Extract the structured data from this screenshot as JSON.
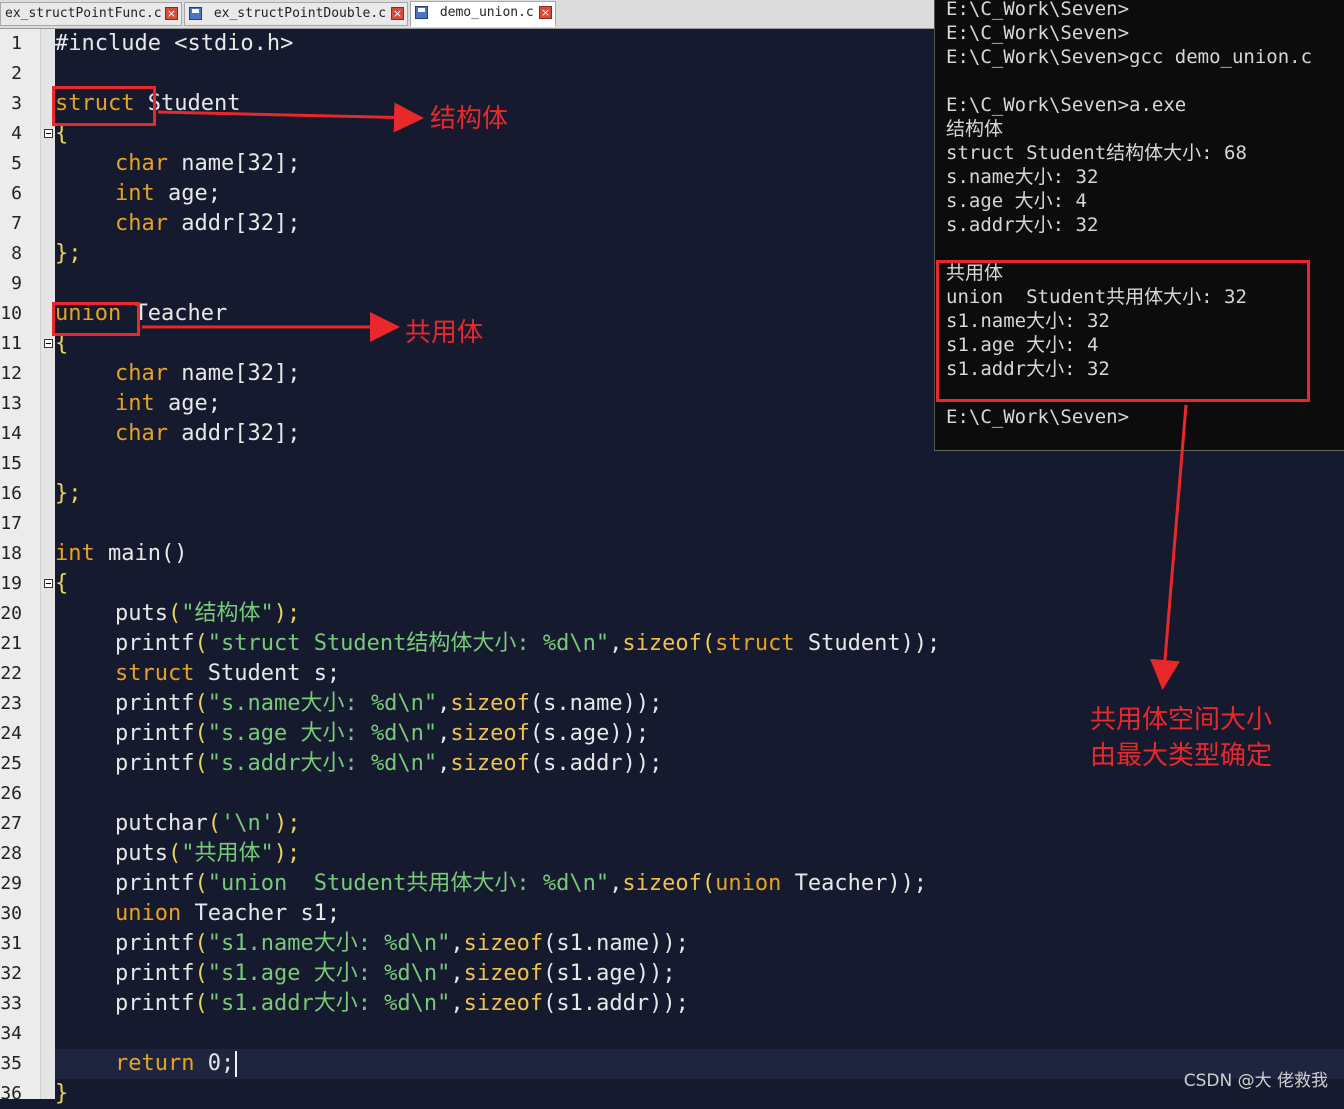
{
  "tabs": [
    {
      "label": "ex_structPointFunc.c",
      "active": false
    },
    {
      "label": "ex_structPointDouble.c",
      "active": false
    },
    {
      "label": "demo_union.c",
      "active": true
    }
  ],
  "line_numbers": [
    "1",
    "2",
    "3",
    "4",
    "5",
    "6",
    "7",
    "8",
    "9",
    "10",
    "11",
    "12",
    "13",
    "14",
    "15",
    "16",
    "17",
    "18",
    "19",
    "20",
    "21",
    "22",
    "23",
    "24",
    "25",
    "26",
    "27",
    "28",
    "29",
    "30",
    "31",
    "32",
    "33",
    "34",
    "35",
    "36"
  ],
  "code": {
    "l1": "#include <stdio.h>",
    "l3_kw": "struct",
    "l3_id": " Student",
    "l4": "{",
    "l5_kw": "char",
    "l5_rest": " name[32];",
    "l6_kw": "int",
    "l6_rest": " age;",
    "l7_kw": "char",
    "l7_rest": " addr[32];",
    "l8": "};",
    "l10_kw": "union",
    "l10_id": " Teacher",
    "l11": "{",
    "l12_kw": "char",
    "l12_rest": " name[32];",
    "l13_kw": "int",
    "l13_rest": " age;",
    "l14_kw": "char",
    "l14_rest": " addr[32];",
    "l16": "};",
    "l18_kw": "int",
    "l18_rest": " main()",
    "l19": "{",
    "l20_fn": "puts",
    "l20_str": "\"结构体\"",
    "l20_end": ");",
    "l21_fn": "printf",
    "l21_str": "\"struct Student结构体大小: %d\\n\"",
    "l21_mid": ",",
    "l21_fn2": "sizeof",
    "l21_kw": "struct",
    "l21_end": " Student));",
    "l22_kw": "struct",
    "l22_rest": " Student s;",
    "l23_fn": "printf",
    "l23_str": "\"s.name大小: %d\\n\"",
    "l23_fn2": "sizeof",
    "l23_end": "(s.name));",
    "l24_fn": "printf",
    "l24_str": "\"s.age 大小: %d\\n\"",
    "l24_fn2": "sizeof",
    "l24_end": "(s.age));",
    "l25_fn": "printf",
    "l25_str": "\"s.addr大小: %d\\n\"",
    "l25_fn2": "sizeof",
    "l25_end": "(s.addr));",
    "l27_fn": "putchar",
    "l27_str": "'\\n'",
    "l27_end": ");",
    "l28_fn": "puts",
    "l28_str": "\"共用体\"",
    "l28_end": ");",
    "l29_fn": "printf",
    "l29_str": "\"union  Student共用体大小: %d\\n\"",
    "l29_fn2": "sizeof",
    "l29_kw": "union",
    "l29_end": " Teacher));",
    "l30_kw": "union",
    "l30_rest": " Teacher s1;",
    "l31_fn": "printf",
    "l31_str": "\"s1.name大小: %d\\n\"",
    "l31_fn2": "sizeof",
    "l31_end": "(s1.name));",
    "l32_fn": "printf",
    "l32_str": "\"s1.age 大小: %d\\n\"",
    "l32_fn2": "sizeof",
    "l32_end": "(s1.age));",
    "l33_fn": "printf",
    "l33_str": "\"s1.addr大小: %d\\n\"",
    "l33_fn2": "sizeof",
    "l33_end": "(s1.addr));",
    "l35_kw": "return",
    "l35_rest": " 0;",
    "l36": "}"
  },
  "console": [
    "E:\\C_Work\\Seven>",
    "E:\\C_Work\\Seven>",
    "E:\\C_Work\\Seven>gcc demo_union.c",
    "",
    "E:\\C_Work\\Seven>a.exe",
    "结构体",
    "struct Student结构体大小: 68",
    "s.name大小: 32",
    "s.age 大小: 4",
    "s.addr大小: 32",
    "",
    "共用体",
    "union  Student共用体大小: 32",
    "s1.name大小: 32",
    "s1.age 大小: 4",
    "s1.addr大小: 32",
    "",
    "E:\\C_Work\\Seven>"
  ],
  "annotations": {
    "struct_label": "结构体",
    "union_label": "共用体",
    "note_line1": "共用体空间大小",
    "note_line2": "由最大类型确定"
  },
  "watermark": "CSDN @大 佬救我",
  "colors": {
    "annotation": "#e8282b",
    "keyword": "#e6a323",
    "string": "#79c97a",
    "editor_bg": "#161a2e"
  }
}
